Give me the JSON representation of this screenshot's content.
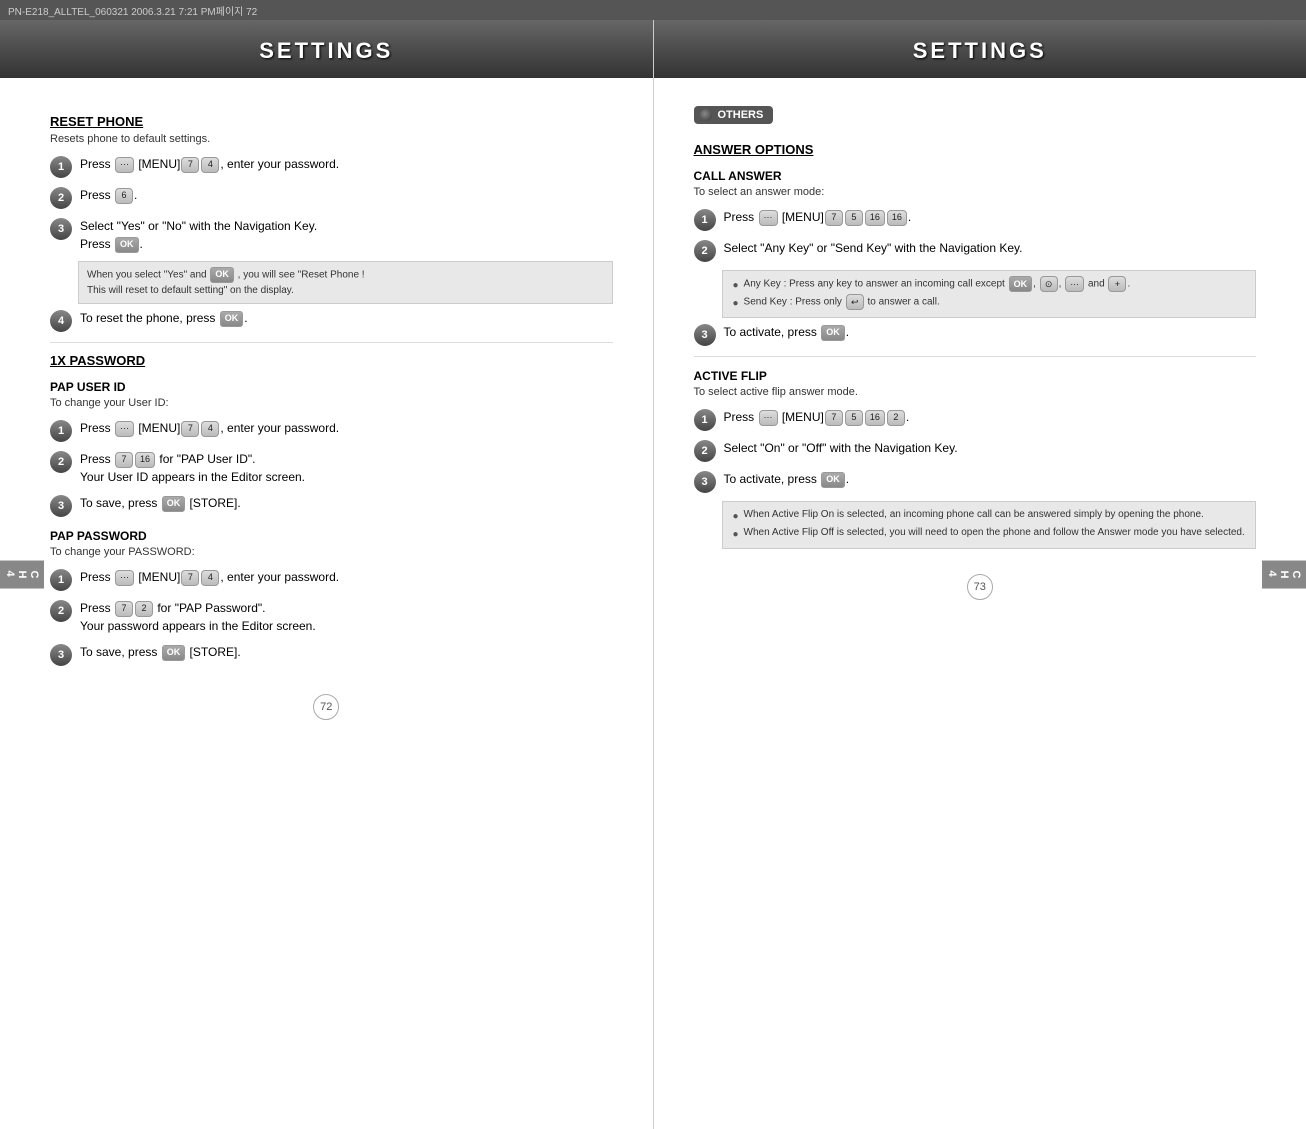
{
  "topbar": {
    "text": "PN-E218_ALLTEL_060321  2006.3.21 7:21 PM페이지 72"
  },
  "left_page": {
    "header": "SETTINGS",
    "sections": {
      "reset_phone": {
        "title": "RESET PHONE",
        "desc": "Resets phone to default settings.",
        "steps": [
          {
            "num": "1",
            "text_before": "Press",
            "key_sequence": "[MENU]",
            "text_after": ", enter your password."
          },
          {
            "num": "2",
            "text": "Press"
          },
          {
            "num": "3",
            "text": "Select \"Yes\" or \"No\" with the Navigation Key.",
            "text2": "Press"
          }
        ],
        "info_box": "When you select \"Yes\" and      , you will see \"Reset Phone ! This will reset to default setting\" on the display.",
        "step4": {
          "num": "4",
          "text": "To reset the phone, press"
        }
      },
      "password_1x": {
        "title": "1X PASSWORD"
      },
      "pap_user_id": {
        "title": "PAP USER ID",
        "desc": "To change your User ID:",
        "steps": [
          {
            "num": "1",
            "text_before": "Press",
            "text_after": ", enter your password."
          },
          {
            "num": "2",
            "text": "Press",
            "text2": "for \"PAP User ID\".",
            "text3": "Your User ID appears in the Editor screen."
          },
          {
            "num": "3",
            "text": "To save, press",
            "text2": "[STORE]."
          }
        ]
      },
      "pap_password": {
        "title": "PAP PASSWORD",
        "desc": "To change your PASSWORD:",
        "steps": [
          {
            "num": "1",
            "text_before": "Press",
            "text_after": ", enter your password."
          },
          {
            "num": "2",
            "text": "Press",
            "text2": "for \"PAP Password\".",
            "text3": "Your password appears in the Editor screen."
          },
          {
            "num": "3",
            "text": "To save, press",
            "text2": "[STORE]."
          }
        ]
      }
    },
    "page_num": "72",
    "ch_label": "CH\n4"
  },
  "right_page": {
    "header": "SETTINGS",
    "others_badge": "OTHERS",
    "sections": {
      "answer_options": {
        "title": "ANSWER OPTIONS"
      },
      "call_answer": {
        "title": "CALL ANSWER",
        "desc": "To select an answer mode:",
        "steps": [
          {
            "num": "1",
            "text_before": "Press",
            "text_after": "."
          },
          {
            "num": "2",
            "text": "Select \"Any Key\" or \"Send Key\" with the Navigation Key."
          },
          {
            "num": "3",
            "text": "To activate, press"
          }
        ],
        "bullet_box": [
          "Any Key : Press any key to answer an incoming call except              ,       ,       and      .",
          "Send Key : Press only       to answer a call."
        ]
      },
      "active_flip": {
        "title": "ACTIVE FLIP",
        "desc": "To select active flip answer mode.",
        "steps": [
          {
            "num": "1",
            "text_before": "Press",
            "text_after": "."
          },
          {
            "num": "2",
            "text": "Select \"On\" or \"Off\" with the Navigation Key."
          },
          {
            "num": "3",
            "text": "To activate, press"
          }
        ],
        "bullet_box": [
          "When Active Flip On is selected, an incoming phone call can be answered simply by opening the phone.",
          "When Active Flip Off is selected, you will need to open the phone and follow the Answer mode you have selected."
        ]
      }
    },
    "page_num": "73",
    "ch_label": "CH\n4"
  }
}
